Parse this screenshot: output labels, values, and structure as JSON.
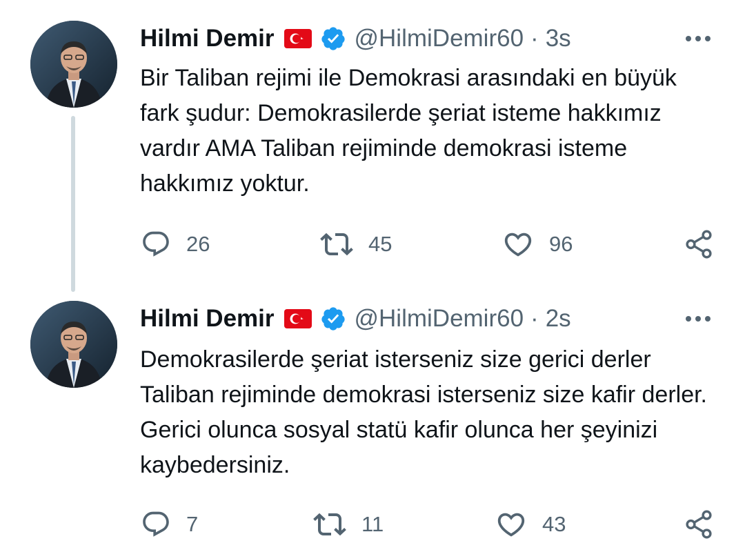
{
  "thread": [
    {
      "author": {
        "name": "Hilmi Demir",
        "handle": "@HilmiDemir60",
        "flag_icon": "turkey-flag-icon",
        "verified_icon": "verified-badge-icon"
      },
      "separator": "·",
      "timestamp": "3s",
      "text": "Bir Taliban rejimi ile Demokrasi arasındaki en büyük fark şudur: Demokrasilerde şeriat isteme hakkımız vardır AMA Taliban rejiminde demokrasi isteme hakkımız yoktur.",
      "actions": {
        "replies": "26",
        "retweets": "45",
        "likes": "96"
      }
    },
    {
      "author": {
        "name": "Hilmi Demir",
        "handle": "@HilmiDemir60",
        "flag_icon": "turkey-flag-icon",
        "verified_icon": "verified-badge-icon"
      },
      "separator": "·",
      "timestamp": "2s",
      "text": "Demokrasilerde şeriat isterseniz size gerici derler Taliban rejiminde demokrasi isterseniz size kafir derler. Gerici olunca sosyal statü kafir olunca her şeyinizi kaybedersiniz.",
      "actions": {
        "replies": "7",
        "retweets": "11",
        "likes": "43"
      }
    }
  ],
  "colors": {
    "text": "#0f1419",
    "secondary": "#536471",
    "verified": "#1d9bf0",
    "flag_red": "#e30a17",
    "thread_line": "#cfd9de"
  }
}
